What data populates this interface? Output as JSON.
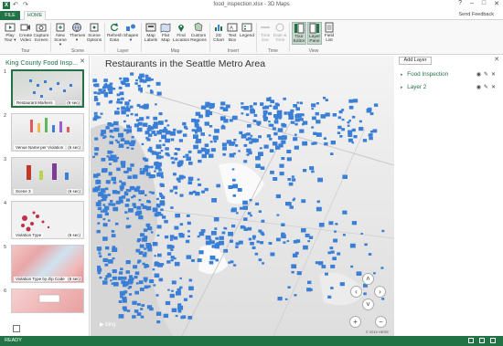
{
  "window": {
    "title": "food_inspection.xlsx - 3D Maps",
    "controls": [
      "?",
      "–",
      "□",
      "✕"
    ]
  },
  "tabs": {
    "file": "FILE",
    "home": "HOME",
    "feedback": "Send Feedback"
  },
  "ribbon": {
    "buttons": {
      "play_tour": "Play Tour ▾",
      "create_video": "Create Video",
      "capture_screen": "Capture Screen",
      "new_scene": "New Scene ▾",
      "themes": "Themes ▾",
      "scene_options": "Scene Options",
      "refresh_data": "Refresh Data",
      "shapes": "Shapes ▾",
      "map_labels": "Map Labels",
      "flat_map": "Flat Map",
      "find_location": "Find Location",
      "custom_regions": "Custom Regions",
      "chart_2d": "2D Chart",
      "text_box": "Text Box",
      "legend": "Legend",
      "time_line": "Time line",
      "date_time": "Date & Time",
      "tour_editor": "Tour Editor",
      "layer_pane": "Layer Pane",
      "field_list": "Field List"
    },
    "groups": {
      "tour": "Tour",
      "scene": "Scene",
      "layer": "Layer",
      "map": "Map",
      "insert": "Insert",
      "time": "Time",
      "view": "View"
    }
  },
  "tour": {
    "title": "King County Food Insp...",
    "close": "✕",
    "scenes": [
      {
        "num": "1",
        "caption": "Restaurant Markers",
        "duration": "(6 sec)"
      },
      {
        "num": "2",
        "caption": "Venue Name per Violation",
        "duration": "(6 sec)"
      },
      {
        "num": "3",
        "caption": "Scene 3",
        "duration": "(6 sec)"
      },
      {
        "num": "4",
        "caption": "Violation Type",
        "duration": "(6 sec)"
      },
      {
        "num": "5",
        "caption": "Violation Type by Zip Code",
        "duration": "(6 sec)"
      },
      {
        "num": "6",
        "caption": "",
        "duration": ""
      }
    ]
  },
  "map": {
    "title": "Restaurants in the Seattle Metro Area",
    "bing": "▶ bing",
    "copyright": "© 2015 HERE",
    "nav": {
      "up": "˄",
      "down": "˅",
      "left": "‹",
      "right": "›",
      "zoom_in": "+",
      "zoom_out": "−"
    },
    "marker_color": "#3a7fd5"
  },
  "layers": {
    "add_layer": "Add Layer",
    "close": "✕",
    "items": [
      {
        "caret": "▸",
        "name": "Food Inspection"
      },
      {
        "caret": "▸",
        "name": "Layer 2"
      }
    ],
    "action_icons": [
      "◉",
      "✎",
      "✕"
    ]
  },
  "status": {
    "ready": "READY"
  },
  "colors": {
    "accent": "#217346",
    "marker": "#3a7fd5"
  }
}
